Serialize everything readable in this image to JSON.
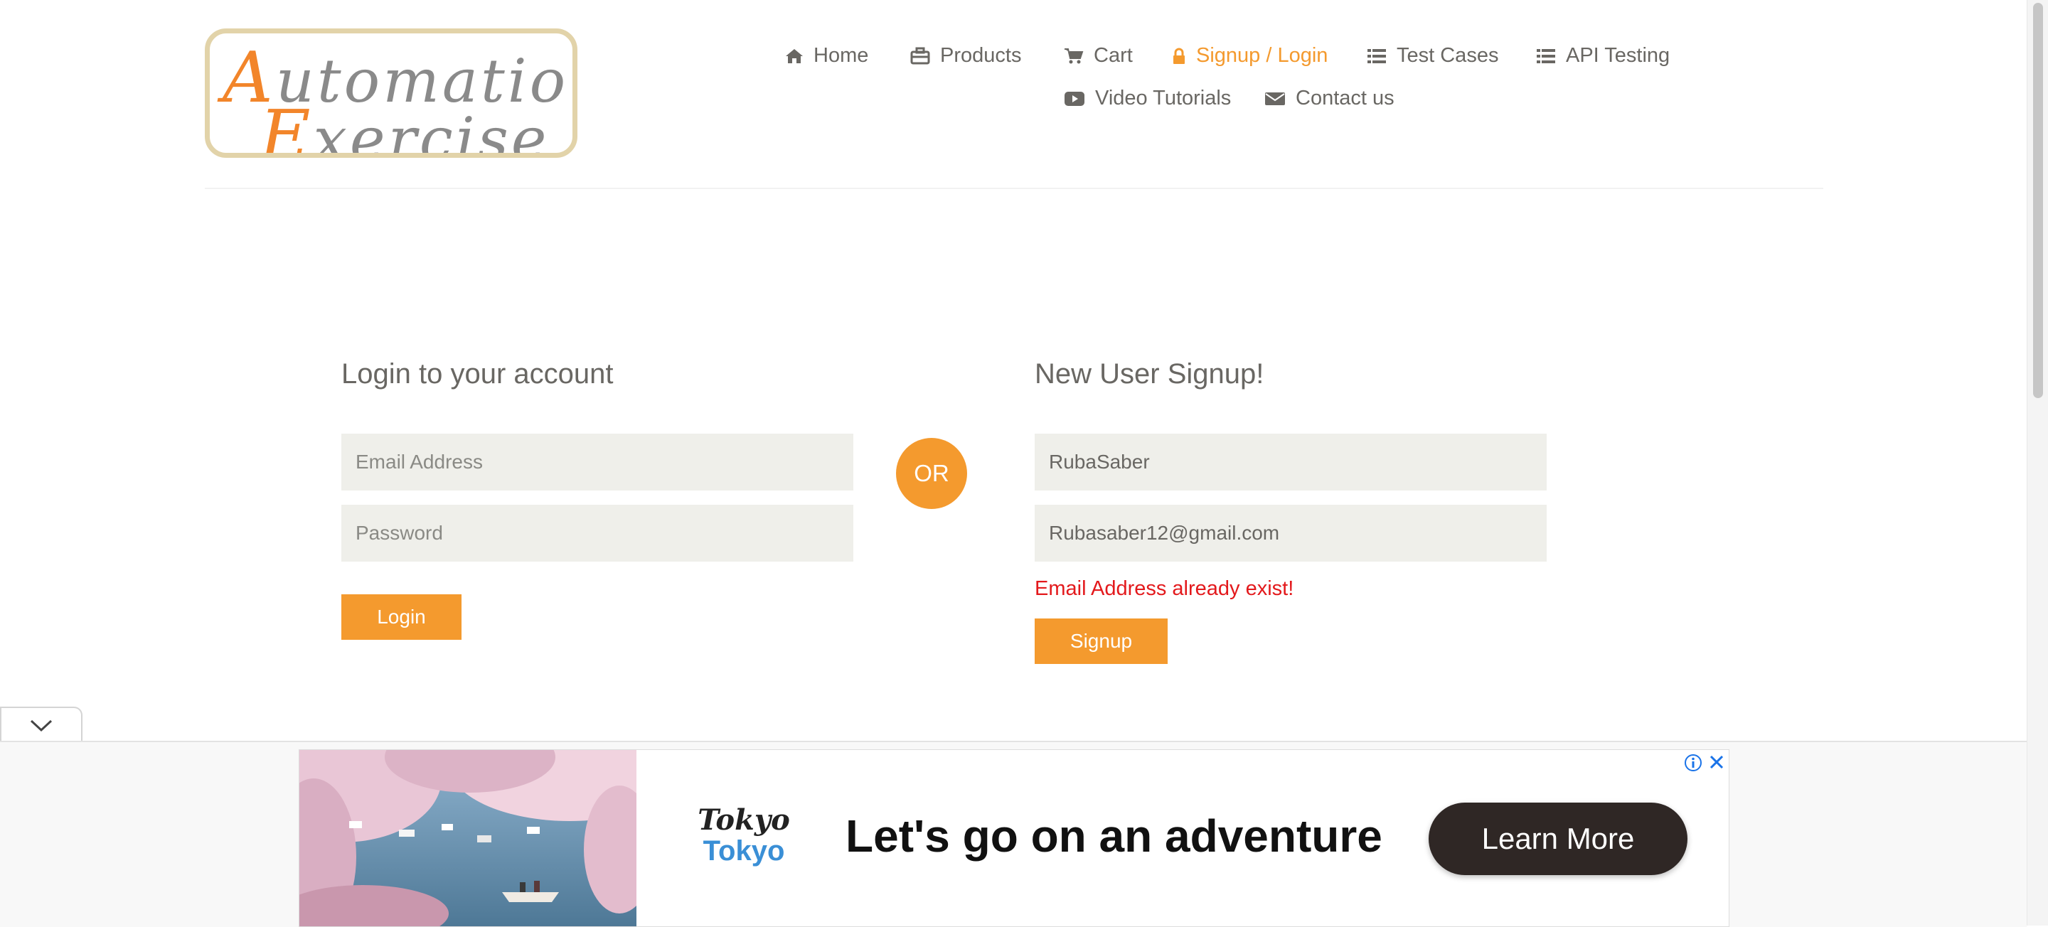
{
  "logo": {
    "line1_cap": "A",
    "line1_rest": "utomation",
    "line2_cap": "E",
    "line2_rest": "xercise"
  },
  "nav": {
    "items": [
      {
        "label": "Home",
        "icon": "home-icon"
      },
      {
        "label": "Products",
        "icon": "briefcase-icon"
      },
      {
        "label": "Cart",
        "icon": "cart-icon"
      },
      {
        "label": "Signup / Login",
        "icon": "lock-icon",
        "active": true
      },
      {
        "label": "Test Cases",
        "icon": "list-icon"
      },
      {
        "label": "API Testing",
        "icon": "list-icon"
      },
      {
        "label": "Video Tutorials",
        "icon": "youtube-play-icon"
      },
      {
        "label": "Contact us",
        "icon": "envelope-icon"
      }
    ]
  },
  "login": {
    "title": "Login to your account",
    "email_placeholder": "Email Address",
    "password_placeholder": "Password",
    "button": "Login"
  },
  "or_label": "OR",
  "signup": {
    "title": "New User Signup!",
    "name_value": "RubaSaber",
    "email_value": "Rubasaber12@gmail.com",
    "error": "Email Address already exist!",
    "button": "Signup"
  },
  "ad": {
    "brand_line1": "Tokyo",
    "brand_line2": "Tokyo",
    "headline": "Let's go on an adventure",
    "cta": "Learn More"
  },
  "colors": {
    "accent": "#f49a2e",
    "error": "#e3191c",
    "text": "#696763",
    "field_bg": "#efefea"
  }
}
